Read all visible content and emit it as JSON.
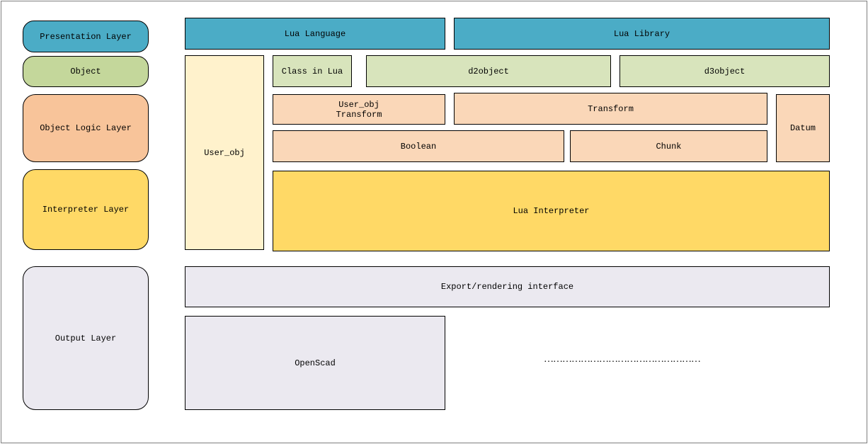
{
  "layers": {
    "presentation": "Presentation Layer",
    "object": "Object",
    "object_logic": "Object Logic Layer",
    "interpreter": "Interpreter Layer",
    "output": "Output Layer"
  },
  "blocks": {
    "lua_language": "Lua Language",
    "lua_library": "Lua Library",
    "user_obj": "User_obj",
    "class_in_lua": "Class in Lua",
    "d2object": "d2object",
    "d3object": "d3object",
    "user_obj_transform": "User_obj\nTransform",
    "transform": "Transform",
    "datum": "Datum",
    "boolean": "Boolean",
    "chunk": "Chunk",
    "lua_interpreter": "Lua Interpreter",
    "export_interface": "Export/rendering interface",
    "openscad": "OpenScad",
    "ellipsis": "……………………………………………"
  },
  "colors": {
    "presentation": "#4BACC6",
    "object": "#C4D79B",
    "object_light": "#D8E4BC",
    "object_logic": "#F8C49A",
    "object_logic_light": "#FAD7B8",
    "interpreter": "#FFD966",
    "user_obj": "#FFF2CC",
    "output": "#EBE9F0"
  }
}
